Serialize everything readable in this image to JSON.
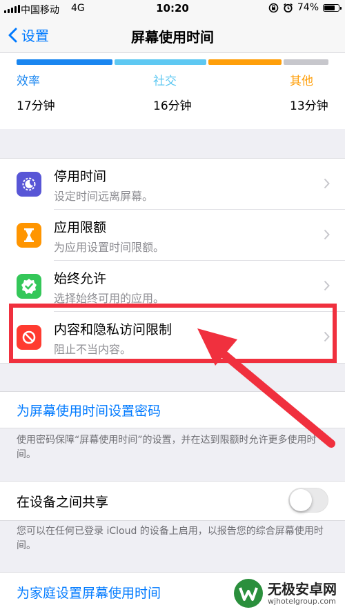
{
  "status_bar": {
    "carrier": "中国移动",
    "network": "4G",
    "time": "10:20",
    "battery": "74%",
    "battery_level": 0.74
  },
  "nav": {
    "back_label": "设置",
    "title": "屏幕使用时间"
  },
  "usage": {
    "bar_colors": [
      "#1a86f0",
      "#5ec8f2",
      "#ff9f0a",
      "#c7c7cc"
    ],
    "categories": [
      {
        "name": "效率",
        "minutes": "17分钟",
        "color": "#1a86f0"
      },
      {
        "name": "社交",
        "minutes": "16分钟",
        "color": "#5ec8f2"
      },
      {
        "name": "其他",
        "minutes": "13分钟",
        "color": "#ff9f0a"
      }
    ]
  },
  "items": [
    {
      "title": "停用时间",
      "subtitle": "设定时间远离屏幕。",
      "icon": "downtime-icon",
      "color": "#5856d6"
    },
    {
      "title": "应用限额",
      "subtitle": "为应用设置时间限额。",
      "icon": "hourglass-icon",
      "color": "#ff9500"
    },
    {
      "title": "始终允许",
      "subtitle": "选择始终可用的应用。",
      "icon": "checkmark-badge-icon",
      "color": "#34c759"
    },
    {
      "title": "内容和隐私访问限制",
      "subtitle": "阻止不当内容。",
      "icon": "restriction-icon",
      "color": "#ff3b30"
    }
  ],
  "passcode": {
    "label": "为屏幕使用时间设置密码",
    "note": "使用密码保障“屏幕使用时间”的设置，并在达到限额时允许更多使用时间。"
  },
  "share": {
    "label": "在设备之间共享",
    "enabled": false,
    "note": "您可以在任何已登录 iCloud 的设备上启用，以报告您的综合屏幕使用时间。"
  },
  "family": {
    "label": "为家庭设置屏幕使用时间"
  },
  "watermark": {
    "brand": "无极安卓网",
    "site": "wjhotelgroup.com"
  },
  "annotation_color": "#f0303e"
}
